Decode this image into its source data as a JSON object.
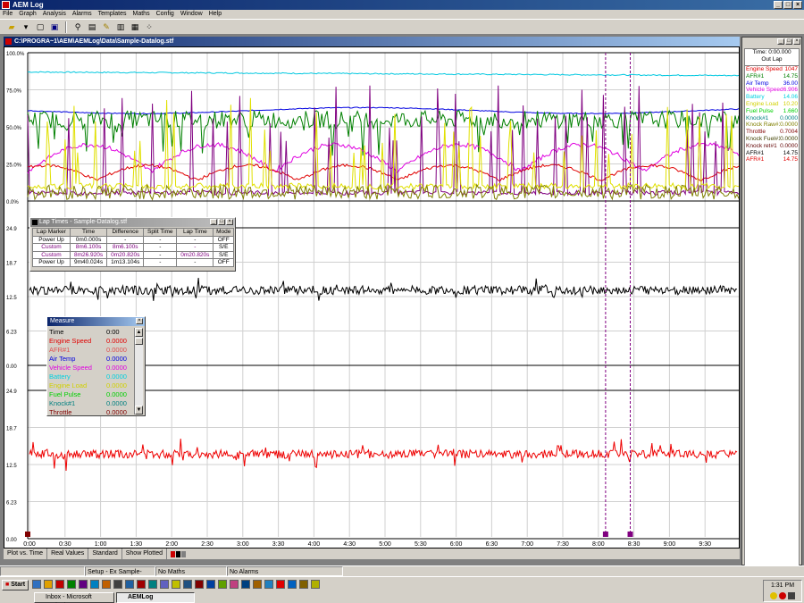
{
  "app": {
    "title": "AEM Log",
    "menu": [
      "File",
      "Graph",
      "Analysis",
      "Alarms",
      "Templates",
      "Maths",
      "Config",
      "Window",
      "Help"
    ]
  },
  "document": {
    "title": "C:\\PROGRA~1\\AEM\\AEMLog\\Data\\Sample-Datalog.stf"
  },
  "plot": {
    "top_axis": [
      "100.0%",
      "75.0%",
      "50.0%",
      "25.0%",
      "0.0%"
    ],
    "mid_axis": [
      "24.9",
      "18.7",
      "12.5",
      "6.23",
      "0.00"
    ],
    "low_axis": [
      "24.9",
      "18.7",
      "12.5",
      "6.23",
      "0.00"
    ],
    "time_labels": [
      "0:00",
      "0:30",
      "1:00",
      "1:30",
      "2:00",
      "2:30",
      "3:00",
      "3:30",
      "4:00",
      "4:30",
      "5:00",
      "5:30",
      "6:00",
      "6:30",
      "7:00",
      "7:30",
      "8:00",
      "8:30",
      "9:00",
      "9:30"
    ]
  },
  "lap_times": {
    "title": "Lap Times - Sample-Datalog.stf",
    "headers": [
      "Lap Marker",
      "Time",
      "Difference",
      "Split Time",
      "Lap Time",
      "Mode"
    ],
    "rows": [
      {
        "marker": "Power Up",
        "time": "0m0.000s",
        "diff": "-",
        "split": "-",
        "lap": "-",
        "mode": "OFF",
        "color": "#000000"
      },
      {
        "marker": "Custom",
        "time": "8m6.100s",
        "diff": "8m6.100s",
        "split": "-",
        "lap": "-",
        "mode": "S/E",
        "color": "#800080"
      },
      {
        "marker": "Custom",
        "time": "8m26.920s",
        "diff": "0m20.820s",
        "split": "-",
        "lap": "0m20.820s",
        "mode": "S/E",
        "color": "#800080"
      },
      {
        "marker": "Power Up",
        "time": "9m40.024s",
        "diff": "1m13.104s",
        "split": "-",
        "lap": "-",
        "mode": "OFF",
        "color": "#000000"
      }
    ]
  },
  "measure": {
    "title": "Measure",
    "rows": [
      {
        "name": "Time",
        "value": "0:00",
        "color": "#000000"
      },
      {
        "name": "Engine Speed",
        "value": "0.0000",
        "color": "#e00000"
      },
      {
        "name": "AFR#1",
        "value": "0.0000",
        "color": "#e05050"
      },
      {
        "name": "Air Temp",
        "value": "0.0000",
        "color": "#0000e0"
      },
      {
        "name": "Vehicle Speed",
        "value": "0.0000",
        "color": "#e000e0"
      },
      {
        "name": "Battery",
        "value": "0.0000",
        "color": "#00d0e0"
      },
      {
        "name": "Engine Load",
        "value": "0.0000",
        "color": "#d0d000"
      },
      {
        "name": "Fuel Pulse",
        "value": "0.0000",
        "color": "#00d000"
      },
      {
        "name": "Knock#1",
        "value": "0.0000",
        "color": "#008080"
      },
      {
        "name": "Throttle",
        "value": "0.0000",
        "color": "#800000"
      }
    ]
  },
  "right_panel": {
    "time_label": "Time: 0:00.000",
    "lap_label": "Out Lap",
    "rows": [
      {
        "name": "Engine Speed",
        "value": "1047",
        "color": "#e00000"
      },
      {
        "name": "AFR#1",
        "value": "14.75",
        "color": "#008000"
      },
      {
        "name": "Air Temp",
        "value": "36.00",
        "color": "#0000e0"
      },
      {
        "name": "Vehicle Speed",
        "value": "6.906",
        "color": "#e000e0"
      },
      {
        "name": "Battery",
        "value": "14.06",
        "color": "#00d0e0"
      },
      {
        "name": "Engine Load",
        "value": "10.20",
        "color": "#d0d000"
      },
      {
        "name": "Fuel Pulse",
        "value": "1.660",
        "color": "#00d000"
      },
      {
        "name": "Knock#1",
        "value": "0.0000",
        "color": "#008080"
      },
      {
        "name": "Knock Raw#1",
        "value": "0.0000",
        "color": "#808000"
      },
      {
        "name": "Throttle",
        "value": "0.7004",
        "color": "#800000"
      },
      {
        "name": "Knock Fuel#1",
        "value": "0.0000",
        "color": "#404000"
      },
      {
        "name": "Knock ret#1",
        "value": "0.0000",
        "color": "#600000"
      },
      {
        "name": "AFR#1",
        "value": "14.75",
        "color": "#000000"
      },
      {
        "name": "AFR#1",
        "value": "14.75",
        "color": "#e00000"
      }
    ]
  },
  "status": {
    "plot_mode": "Plot vs. Time",
    "values_mode": "Real Values",
    "view": "Standard",
    "show": "Show Plotted"
  },
  "app_status": {
    "setup": "Setup - Ex Sample-Datalog.s",
    "maths": "No Maths",
    "alarms": "No Alarms"
  },
  "taskbar": {
    "start": "Start",
    "tasks": [
      "Inbox - Microsoft Outlook",
      "AEMLog"
    ],
    "clock": "1:31 PM"
  },
  "colors": {
    "black_trace": "#000000",
    "red_trace": "#ee0000",
    "marker": "#800080"
  }
}
